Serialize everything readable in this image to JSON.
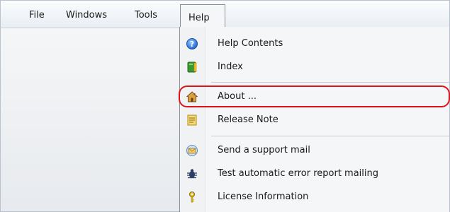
{
  "menubar": {
    "items": [
      {
        "label": "File"
      },
      {
        "label": "Windows"
      },
      {
        "label": "Tools"
      },
      {
        "label": "Help"
      }
    ]
  },
  "help_menu": {
    "items": [
      {
        "label": "Help Contents",
        "icon": "help-circle-icon"
      },
      {
        "label": "Index",
        "icon": "book-icon"
      },
      {
        "label": "About ...",
        "icon": "home-icon",
        "highlighted": true
      },
      {
        "label": "Release Note",
        "icon": "note-icon"
      },
      {
        "label": "Send a support mail",
        "icon": "mail-icon"
      },
      {
        "label": "Test automatic error report mailing",
        "icon": "bug-icon"
      },
      {
        "label": "License Information",
        "icon": "key-icon"
      }
    ]
  },
  "colors": {
    "highlight_border": "#e0121a",
    "menu_background": "#f5f6f7"
  }
}
